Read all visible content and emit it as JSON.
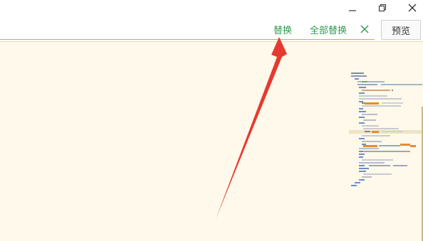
{
  "window_controls": {
    "minimize_icon": "minimize-icon",
    "restore_icon": "restore-icon",
    "close_icon": "close-icon"
  },
  "find_replace": {
    "replace_label": "替换",
    "replace_all_label": "全部替换",
    "close_icon": "close-icon"
  },
  "preview_button": {
    "label": "预览"
  },
  "colors": {
    "accent_green": "#2e9a4e",
    "editor_bg": "#fef9ea",
    "arrow_red": "#e8392f",
    "minimap_orange": "#e58a3a",
    "minimap_blue": "#6d8fc4",
    "minimap_green": "#5fae7a"
  }
}
